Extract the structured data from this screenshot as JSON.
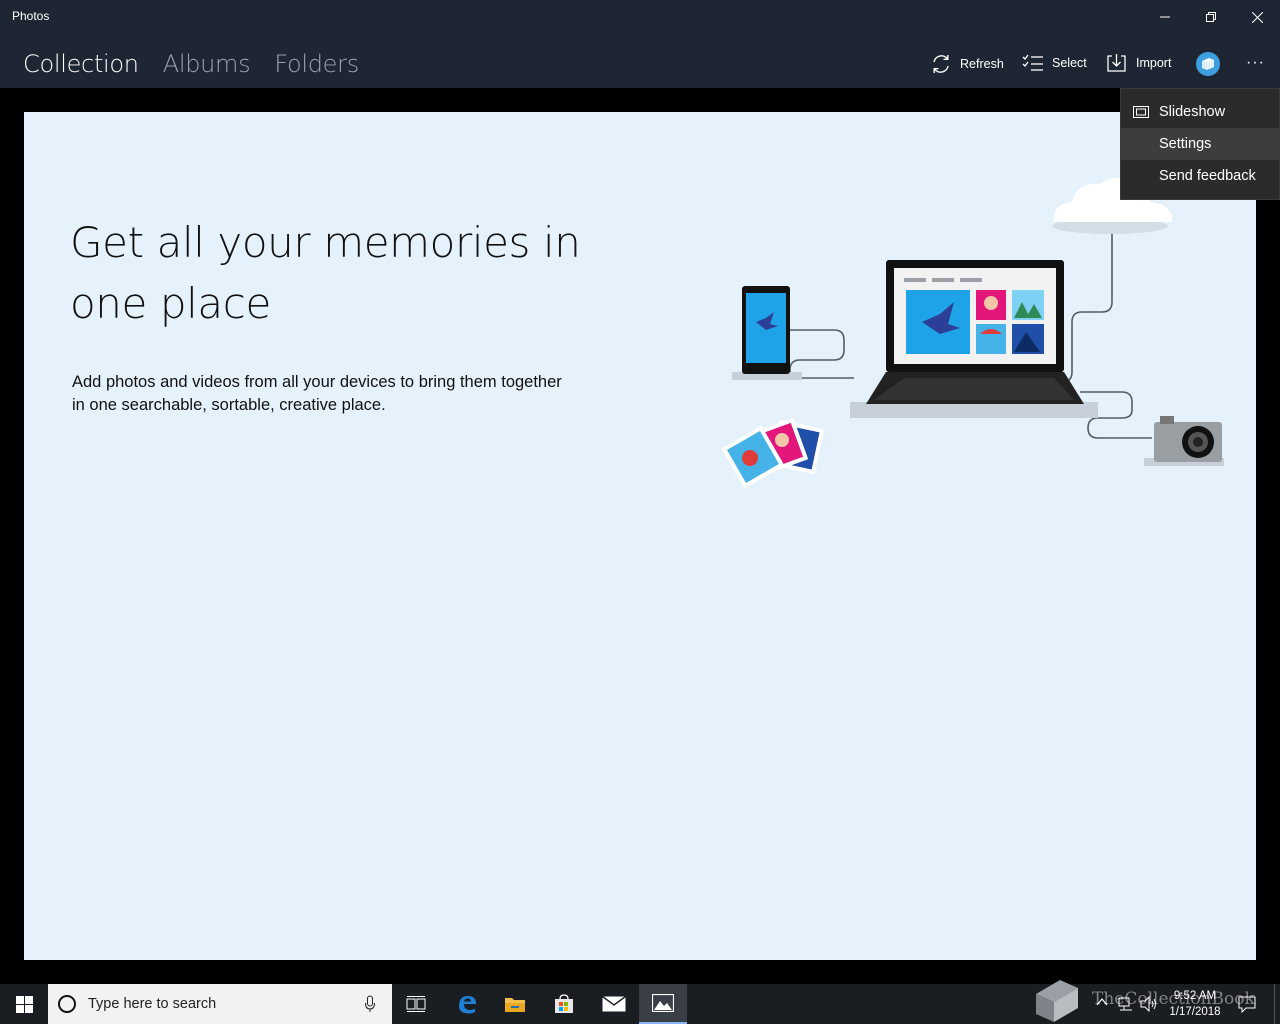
{
  "window": {
    "title": "Photos"
  },
  "nav": {
    "tabs": [
      {
        "label": "Collection"
      },
      {
        "label": "Albums"
      },
      {
        "label": "Folders"
      }
    ]
  },
  "toolbar": {
    "refresh_label": "Refresh",
    "select_label": "Select",
    "import_label": "Import",
    "more_label": "···"
  },
  "main": {
    "headline": "Get all your memories in one place",
    "body": "Add photos and videos from all your devices to bring them together in one searchable, sortable, creative place."
  },
  "menu": {
    "items": [
      {
        "label": "Slideshow"
      },
      {
        "label": "Settings"
      },
      {
        "label": "Send feedback"
      }
    ]
  },
  "taskbar": {
    "search_placeholder": "Type here to search",
    "time": "9:52 AM",
    "date": "1/17/2018",
    "watermark": "TheCollectionBook"
  },
  "colors": {
    "titlebar": "#1f2633",
    "content_bg": "#e6f2fb",
    "accent": "#1fa3e8"
  }
}
